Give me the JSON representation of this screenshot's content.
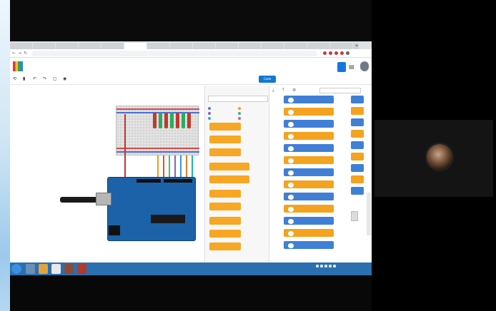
{
  "browser": {
    "tabs": [
      "",
      "",
      "",
      "",
      "",
      "",
      "",
      "",
      "",
      "",
      "",
      "",
      "",
      "",
      ""
    ],
    "active_tab_index": 5,
    "url": ""
  },
  "tinkercad": {
    "project_title": "",
    "save_status": "",
    "toolbar": {
      "code_label": "Code",
      "simulation_label": "",
      "export_label": "",
      "share_label": ""
    },
    "blocks": {
      "category_dropdown": "",
      "categories": [
        {
          "label": "",
          "color": "#4a7fd4"
        },
        {
          "label": "",
          "color": "#f5a21f"
        },
        {
          "label": "",
          "color": "#8a5cc7"
        },
        {
          "label": "",
          "color": "#3cb371"
        },
        {
          "label": "",
          "color": "#29a8d8"
        },
        {
          "label": "",
          "color": "#e0558e"
        }
      ],
      "palette_footer": "",
      "serial_dropdown": "",
      "code_blocks": [
        {
          "text": "",
          "color": "blue"
        },
        {
          "text": "",
          "color": "orange"
        },
        {
          "text": "",
          "color": "blue"
        },
        {
          "text": "",
          "color": "orange"
        },
        {
          "text": "",
          "color": "blue"
        },
        {
          "text": "",
          "color": "orange"
        },
        {
          "text": "",
          "color": "blue"
        },
        {
          "text": "",
          "color": "orange"
        },
        {
          "text": "",
          "color": "blue"
        },
        {
          "text": "",
          "color": "orange"
        },
        {
          "text": "",
          "color": "blue"
        },
        {
          "text": "",
          "color": "orange"
        },
        {
          "text": "",
          "color": "blue"
        }
      ]
    }
  },
  "taskbar": {
    "time": "",
    "date": ""
  },
  "meeting": {
    "participant_name": "",
    "colors": {
      "accent": "#1477d2",
      "block_blue": "#3f7fd6",
      "block_orange": "#f5a21f"
    }
  }
}
